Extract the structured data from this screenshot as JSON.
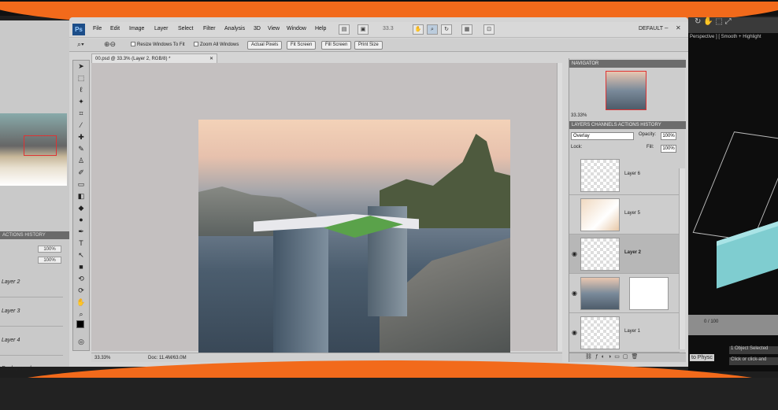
{
  "menubar": {
    "items": [
      "File",
      "Edit",
      "Image",
      "Layer",
      "Select",
      "Filter",
      "Analysis",
      "3D",
      "View",
      "Window",
      "Help"
    ],
    "zoom_field": "33.3",
    "workspace": "DEFAULT"
  },
  "options": {
    "resize_windows": "Resize Windows To Fit",
    "zoom_all": "Zoom All Windows",
    "actual_pixels": "Actual Pixels",
    "fit_screen": "Fit Screen",
    "fill_screen": "Fill Screen",
    "print_size": "Print Size"
  },
  "document": {
    "tab": "00.psd @ 33.3% (Layer 2, RGB/8) *",
    "zoom": "33.33%",
    "doc_size": "Doc: 11.4M/63.0M"
  },
  "navigator": {
    "title": "NAVIGATOR",
    "zoom": "33.33%"
  },
  "layers_panel": {
    "tabs": "LAYERS   CHANNELS  ACTIONS  HISTORY",
    "blend_mode": "Overlay",
    "opacity_label": "Opacity:",
    "opacity": "100%",
    "lock_label": "Lock:",
    "fill_label": "Fill:",
    "fill": "100%",
    "layers": [
      {
        "name": "Layer 6",
        "visible": false,
        "selected": false
      },
      {
        "name": "Layer 5",
        "visible": false,
        "selected": false
      },
      {
        "name": "Layer 2",
        "visible": true,
        "selected": true
      },
      {
        "name": "",
        "visible": true,
        "selected": false
      },
      {
        "name": "Layer 1",
        "visible": true,
        "selected": false
      }
    ]
  },
  "left_window": {
    "panel_tabs": "ACTIONS  HISTORY",
    "opacity": "100%",
    "fill": "100%",
    "layers": [
      "Layer 2",
      "Layer 3",
      "Layer 4",
      "Background"
    ]
  },
  "max_window": {
    "viewport_label": "Perspective ] [ Smooth + Highlight",
    "timeline": "0 / 100",
    "status": "1 Object Selected",
    "prompt": "Click or click-and",
    "physc": "to Physc"
  },
  "colors": {
    "frame_orange": "#f26a1b",
    "ps_chrome": "#d4d4d4",
    "selection_red": "#dd3333"
  }
}
